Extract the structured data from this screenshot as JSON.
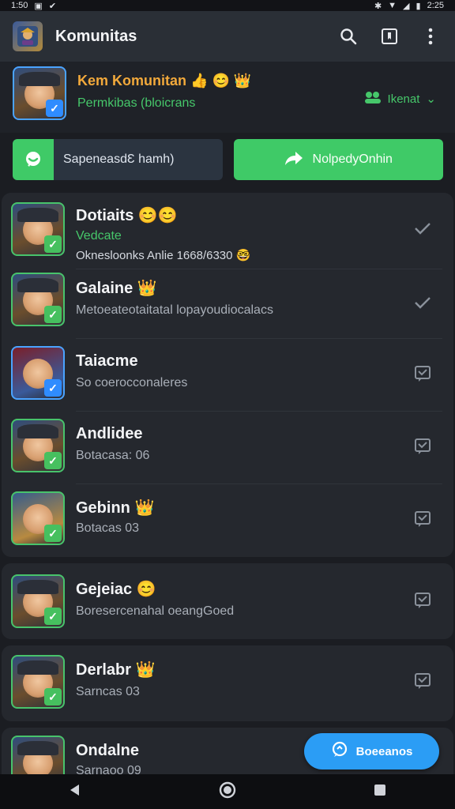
{
  "status_bar": {
    "time": "1:50",
    "right_time": "2:25"
  },
  "app_bar": {
    "title": "Komunitas",
    "icons": [
      "app-logo",
      "search-icon",
      "bookmark-icon",
      "more-vert-icon"
    ]
  },
  "profile": {
    "name": "Kem Komunitan",
    "emoji": "👍 😊 👑",
    "subtitle": "Permkibas (bloicrans",
    "follow_label": "Ikenat"
  },
  "buttons": {
    "left_label": "SapeneasdƐ hamh)",
    "right_label": "NolpedyOnhin"
  },
  "items": [
    {
      "title": "Dotiaits",
      "emoji": "😊😊",
      "subtitle": "Vedcate",
      "subtitle_style": "green",
      "extra": "Oknesloonks Anlie 1668/6330",
      "extra_emoji": "🤓",
      "trail": "check"
    },
    {
      "title": "Galaine",
      "emoji": "👑",
      "subtitle": "Metoeateotaitatal lopayoudiocalacs",
      "trail": "check"
    },
    {
      "title": "Taiacme",
      "emoji": "",
      "subtitle": "So coerocconaleres",
      "trail": "chat"
    },
    {
      "title": "Andlidee",
      "emoji": "",
      "subtitle": "Botacasa: 06",
      "trail": "chat"
    },
    {
      "title": "Gebinn",
      "emoji": "👑",
      "subtitle": "Botacas 03",
      "trail": "chat"
    },
    {
      "title": "Gejeiac",
      "emoji": "😊",
      "subtitle": "Boresercenahal oeangGoed",
      "trail": "chat"
    },
    {
      "title": "Derlabr",
      "emoji": "👑",
      "subtitle": "Sarncas 03",
      "trail": "chat"
    },
    {
      "title": "Ondalne",
      "emoji": "",
      "subtitle": "Sarnaoo 09",
      "trail": "chat"
    }
  ],
  "fab": {
    "label": "Boeeanos"
  },
  "nav": [
    "back-icon",
    "home-icon",
    "recents-icon"
  ]
}
